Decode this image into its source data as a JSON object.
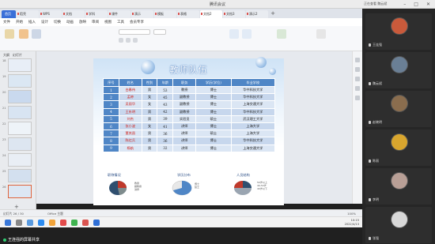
{
  "meeting": {
    "title": "腾讯会议",
    "share_label": "王连强的屏幕共享",
    "viewer_badge": "正在查看 魏云斌"
  },
  "browser_tabs": [
    {
      "label": "首页"
    },
    {
      "label": "稻壳"
    },
    {
      "label": "WPS"
    },
    {
      "label": "文档"
    },
    {
      "label": "学科"
    },
    {
      "label": "课件"
    },
    {
      "label": "演示"
    },
    {
      "label": "模板"
    },
    {
      "label": "表格"
    },
    {
      "label": "文档2"
    },
    {
      "label": "文档3"
    },
    {
      "label": "演示2"
    }
  ],
  "menu": [
    "文件",
    "开始",
    "插入",
    "设计",
    "切换",
    "动画",
    "放映",
    "审阅",
    "视图",
    "工具",
    "会员专享"
  ],
  "popup": {
    "line1": "文本",
    "line2": "选择性粘贴"
  },
  "slide_panel": {
    "tabs": [
      "大纲",
      "幻灯片"
    ],
    "numbers": [
      "18",
      "19",
      "20",
      "21",
      "22",
      "23",
      "24",
      "25",
      "26",
      "27"
    ],
    "add_label": "+"
  },
  "slide": {
    "title": "教师队伍",
    "headers": [
      "序号",
      "姓名",
      "性别",
      "年龄",
      "职务",
      "学历(学位)",
      "毕业学校"
    ],
    "rows": [
      {
        "no": "1",
        "name": "白春伟",
        "sex": "男",
        "age": "53",
        "title": "教授",
        "degree": "博士",
        "school": "华中科技大学",
        "red": true
      },
      {
        "no": "2",
        "name": "孟婷",
        "sex": "女",
        "age": "45",
        "title": "副教授",
        "degree": "博士",
        "school": "华中科技大学",
        "red": true
      },
      {
        "no": "3",
        "name": "吴丽华",
        "sex": "女",
        "age": "43",
        "title": "副教授",
        "degree": "博士",
        "school": "上海交通大学",
        "red": true
      },
      {
        "no": "4",
        "name": "王东明",
        "sex": "男",
        "age": "42",
        "title": "副教授",
        "degree": "博士",
        "school": "华中科技大学",
        "red": true
      },
      {
        "no": "5",
        "name": "刘杰",
        "sex": "男",
        "age": "39",
        "title": "实验员",
        "degree": "硕士",
        "school": "武汉理工大学",
        "red": true
      },
      {
        "no": "6",
        "name": "张小波",
        "sex": "女",
        "age": "41",
        "title": "讲师",
        "degree": "博士",
        "school": "上海大学",
        "red": true
      },
      {
        "no": "7",
        "name": "董其昌",
        "sex": "男",
        "age": "36",
        "title": "讲师",
        "degree": "硕士",
        "school": "上海大学",
        "red": true
      },
      {
        "no": "8",
        "name": "陈红兵",
        "sex": "男",
        "age": "36",
        "title": "讲师",
        "degree": "博士",
        "school": "华中科技大学",
        "red": true
      },
      {
        "no": "9",
        "name": "杨航",
        "sex": "男",
        "age": "32",
        "title": "讲师",
        "degree": "博士",
        "school": "上海交通大学",
        "red": true
      }
    ],
    "charts": [
      {
        "title": "职称情况",
        "legend": [
          "教授",
          "副教授",
          "讲师"
        ],
        "colors": [
          "#c0392b",
          "#2f4f6f",
          "#7f8c8d"
        ]
      },
      {
        "title": "学历分布",
        "legend": [
          "博士",
          "硕士"
        ],
        "colors": [
          "#4f86c6",
          "#dcdcdc"
        ]
      },
      {
        "title": "人员结构",
        "legend": [
          "50岁以上",
          "40-50岁",
          "40岁以下"
        ],
        "colors": [
          "#c0392b",
          "#2f4f6f",
          "#9aa5b1"
        ]
      }
    ]
  },
  "statusbar": {
    "left": "幻灯片 26 / 30",
    "theme": "Office 主题",
    "zoom": "100%"
  },
  "taskbar": {
    "time": "10:15",
    "date": "2022/4/13"
  },
  "participants": [
    {
      "name": "王连强",
      "color": "#c95a3b"
    },
    {
      "name": "魏云斌",
      "color": "#6a7f95"
    },
    {
      "name": "赵晓明",
      "color": "#8a6d4e"
    },
    {
      "name": "陈丽",
      "color": "#d9a62e"
    },
    {
      "name": "李明",
      "color": "#b89f96"
    },
    {
      "name": "张强",
      "color": "#d8d8d8"
    }
  ]
}
